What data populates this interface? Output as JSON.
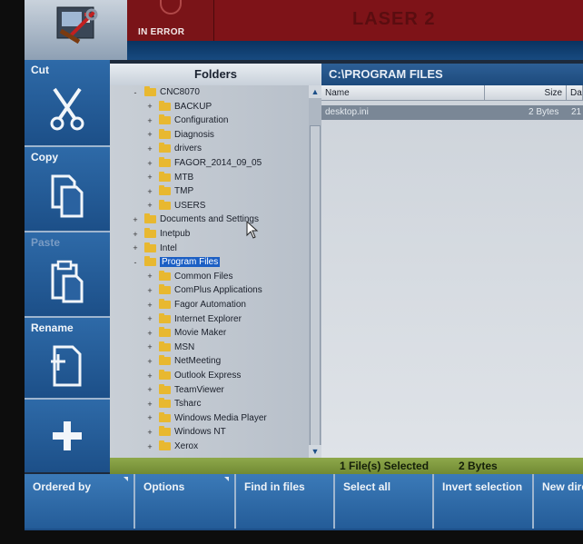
{
  "header": {
    "status_text": "IN ERROR",
    "machine_name": "LASER 2"
  },
  "toolbar": {
    "cut_label": "Cut",
    "copy_label": "Copy",
    "paste_label": "Paste",
    "rename_label": "Rename"
  },
  "folders": {
    "title": "Folders",
    "items": [
      {
        "label": "CNC8070",
        "toggle": "-"
      },
      {
        "label": "BACKUP",
        "toggle": "+"
      },
      {
        "label": "Configuration",
        "toggle": "+"
      },
      {
        "label": "Diagnosis",
        "toggle": "+"
      },
      {
        "label": "drivers",
        "toggle": "+"
      },
      {
        "label": "FAGOR_2014_09_05",
        "toggle": "+"
      },
      {
        "label": "MTB",
        "toggle": "+"
      },
      {
        "label": "TMP",
        "toggle": "+"
      },
      {
        "label": "USERS",
        "toggle": "+"
      },
      {
        "label": "Documents and Settings",
        "toggle": "+"
      },
      {
        "label": "Inetpub",
        "toggle": "+"
      },
      {
        "label": "Intel",
        "toggle": "+"
      },
      {
        "label": "Program Files",
        "toggle": "-"
      },
      {
        "label": "Common Files",
        "toggle": "+"
      },
      {
        "label": "ComPlus Applications",
        "toggle": "+"
      },
      {
        "label": "Fagor Automation",
        "toggle": "+"
      },
      {
        "label": "Internet Explorer",
        "toggle": "+"
      },
      {
        "label": "Movie Maker",
        "toggle": "+"
      },
      {
        "label": "MSN",
        "toggle": "+"
      },
      {
        "label": "NetMeeting",
        "toggle": "+"
      },
      {
        "label": "Outlook Express",
        "toggle": "+"
      },
      {
        "label": "TeamViewer",
        "toggle": "+"
      },
      {
        "label": "Tsharc",
        "toggle": "+"
      },
      {
        "label": "Windows Media Player",
        "toggle": "+"
      },
      {
        "label": "Windows NT",
        "toggle": "+"
      },
      {
        "label": "Xerox",
        "toggle": "+"
      }
    ]
  },
  "files": {
    "path": "C:\\PROGRAM FILES",
    "columns": {
      "name": "Name",
      "size": "Size",
      "date": "Da"
    },
    "rows": [
      {
        "name": "desktop.ini",
        "size": "2 Bytes",
        "date": "21"
      }
    ]
  },
  "status_bar": {
    "selected_text": "1 File(s) Selected",
    "size_text": "2 Bytes"
  },
  "softkeys": {
    "ordered_by": "Ordered by",
    "options": "Options",
    "find_in_files": "Find in files",
    "select_all": "Select all",
    "invert_selection": "Invert selection",
    "new_dir": "New dire"
  }
}
